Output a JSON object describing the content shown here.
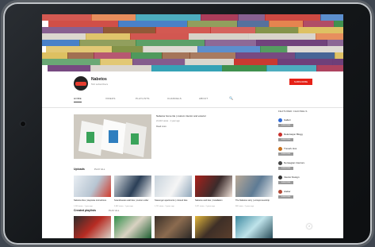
{
  "channel": {
    "name": "Nabetos",
    "subscribers": "512 subscribers",
    "subscribe_label": "SUBSCRIBE"
  },
  "tabs": [
    "HOME",
    "VIDEOS",
    "PLAYLISTS",
    "CHANNELS",
    "ABOUT"
  ],
  "featured": {
    "title": "Nabetos home tile | custom interior and exterior",
    "meta": "24,416 views · 1 year ago",
    "desc": "Read more"
  },
  "uploads": {
    "title": "Uploads",
    "play_all": "PLAY ALL",
    "videos": [
      {
        "title": "Nabetos tiles | stepwise instructions",
        "meta": "1,203 views · 1 year ago",
        "colors": [
          "#e9eef3",
          "#b7c5d2",
          "#d23b2c"
        ]
      },
      {
        "title": "Scandinavian wall tiles | custom order",
        "meta": "3,582 views · 1 year ago",
        "colors": [
          "#d7dce0",
          "#2b3f57",
          "#f2f2f2"
        ]
      },
      {
        "title": "Stavenger apartments | colored tiles",
        "meta": "1,711 views · 2 years ago",
        "colors": [
          "#c8d3dc",
          "#f5f5f5",
          "#8fa7bb"
        ]
      },
      {
        "title": "Nabetos wall tiles | installation",
        "meta": "2,071 views · 2 years ago",
        "colors": [
          "#a9211b",
          "#3b2b2b",
          "#f0e2d8"
        ]
      },
      {
        "title": "The Nabetos story | entrepreneurship",
        "meta": "982 views · 2 years ago",
        "colors": [
          "#b8a897",
          "#5e7b95",
          "#e6e8ea"
        ]
      }
    ]
  },
  "second_row": {
    "title": "Created playlists",
    "play_all": "PLAY ALL",
    "colors": [
      [
        "#2b2b2b",
        "#b72c23",
        "#d8d2c8"
      ],
      [
        "#2f8f4a",
        "#d9d2c2",
        "#1f5f33"
      ],
      [
        "#3a3029",
        "#8b6b4f",
        "#2d2a27"
      ],
      [
        "#e3b73c",
        "#3e2f27",
        "#5b3f2d"
      ],
      [
        "#3e8aa0",
        "#bfe3ea",
        "#2a4e5b"
      ]
    ]
  },
  "sidebar": {
    "header": "FEATURED CHANNELS",
    "subscribe_label": "SUBSCRIBE",
    "channels": [
      {
        "name": "Galleri",
        "color": "#2e69d6"
      },
      {
        "name": "Dekorasjon Blogg",
        "color": "#c9302c"
      },
      {
        "name": "Treverk Hus",
        "color": "#c56f1c"
      },
      {
        "name": "Norwegian Interiors",
        "color": "#444444"
      },
      {
        "name": "Interior Design",
        "color": "#333333"
      },
      {
        "name": "Atelier",
        "color": "#b44a37"
      }
    ]
  },
  "banner_palette": [
    "#3e8f4c",
    "#c9332b",
    "#2a6cbf",
    "#d9b74a",
    "#8c4f2b",
    "#6d3d78",
    "#e06c2c",
    "#2e9fb4",
    "#7a8a3a",
    "#a32a4a",
    "#d7d2c8",
    "#3b5a8f"
  ]
}
